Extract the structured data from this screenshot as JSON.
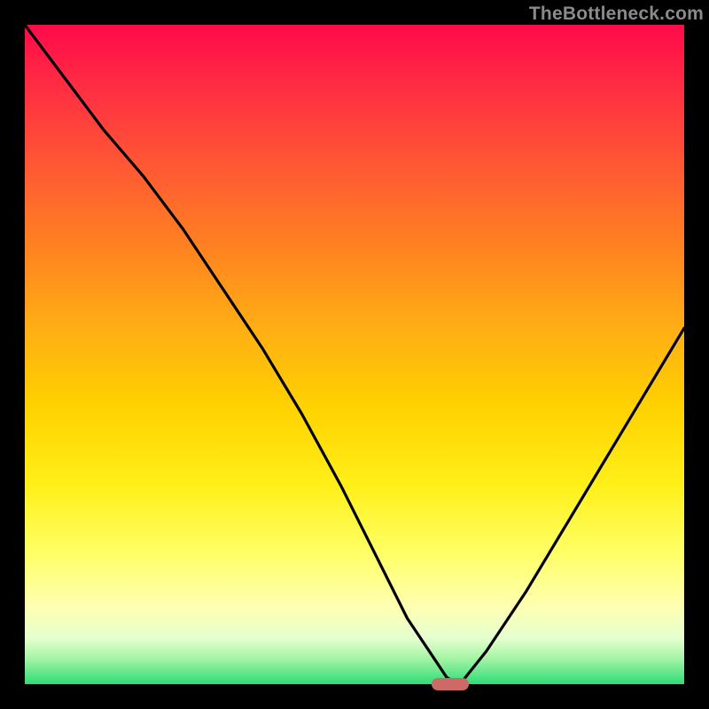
{
  "watermark": "TheBottleneck.com",
  "colors": {
    "curve_stroke": "#000000",
    "marker_fill": "#cc6b66"
  },
  "chart_data": {
    "type": "line",
    "title": "",
    "xlabel": "",
    "ylabel": "",
    "xlim": [
      0,
      100
    ],
    "ylim": [
      0,
      100
    ],
    "grid": false,
    "legend": "none",
    "series": [
      {
        "name": "bottleneck-curve",
        "x": [
          0,
          6,
          12,
          18,
          24,
          30,
          36,
          42,
          48,
          54,
          58,
          62,
          64,
          66,
          70,
          76,
          82,
          88,
          94,
          100
        ],
        "values": [
          100,
          92,
          84,
          77,
          69,
          60,
          51,
          41,
          30,
          18,
          10,
          4,
          1,
          0,
          5,
          14,
          24,
          34,
          44,
          54
        ]
      }
    ],
    "annotations": [
      {
        "name": "optimal-marker",
        "x": 64.5,
        "y": 0
      }
    ]
  }
}
